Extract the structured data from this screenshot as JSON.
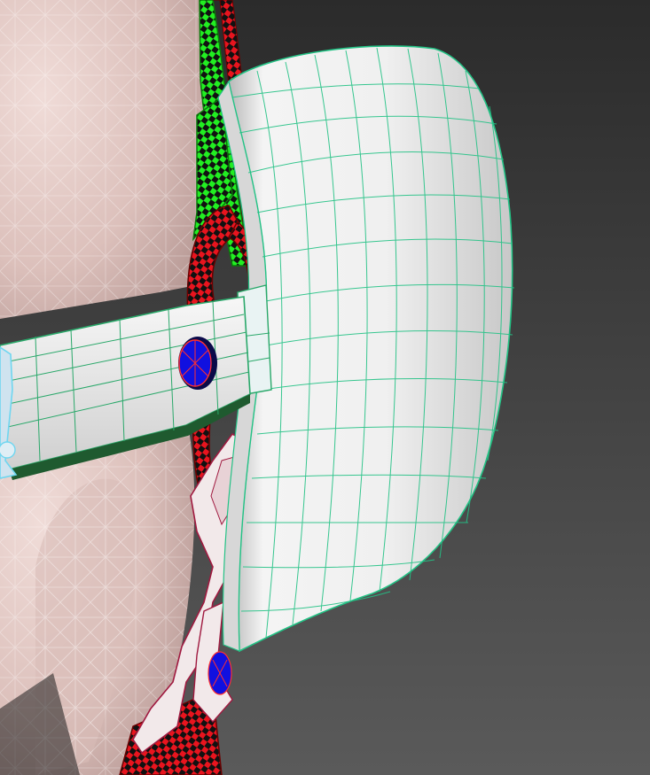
{
  "viewport": {
    "background_top": "#2b2b2b",
    "background_bottom": "#5a5a5a"
  },
  "colors": {
    "skin": "#e6cfca",
    "skin_wire": "#ffffff",
    "shell": "#efefef",
    "shell_wire": "#23c285",
    "strap": "#e7e7e7",
    "strap_wire": "#2aa86a",
    "chain_link": "#f2e9ea",
    "chain_wire": "#a01a40",
    "cable_green": "#22ee22",
    "cable_red": "#e8141e",
    "cable_black": "#111111",
    "rivet": "#1010e0",
    "buckle": "#cfe3ef",
    "buckle_wire": "#6fd6f0"
  }
}
